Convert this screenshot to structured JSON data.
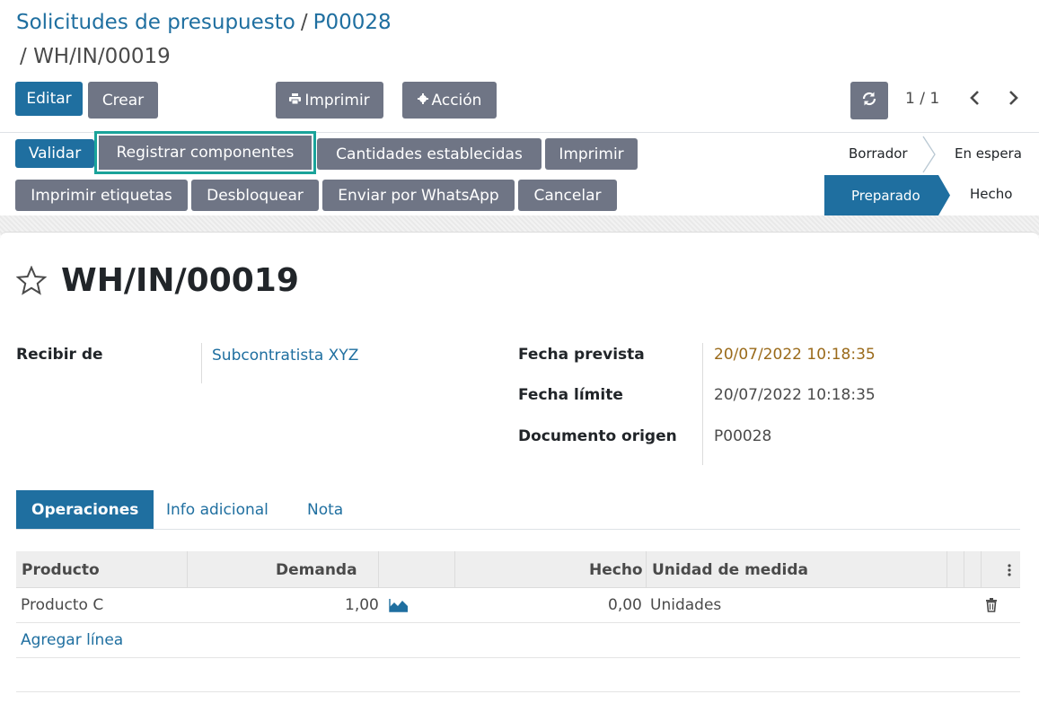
{
  "breadcrumb": {
    "root": "Solicitudes de presupuesto",
    "separator": "/",
    "parent": "P00028",
    "current_prefix": "/",
    "current": "WH/IN/00019"
  },
  "control_buttons": {
    "edit": "Editar",
    "create": "Crear",
    "print": "Imprimir",
    "action": "Acción"
  },
  "pager": {
    "value": "1 / 1"
  },
  "header_buttons": {
    "validate": "Validar",
    "register_components": "Registrar componentes",
    "set_quantities": "Cantidades establecidas",
    "print": "Imprimir",
    "print_labels": "Imprimir etiquetas",
    "unlock": "Desbloquear",
    "whatsapp": "Enviar por WhatsApp",
    "cancel": "Cancelar"
  },
  "status": {
    "stages": [
      "Borrador",
      "En espera",
      "Preparado",
      "Hecho"
    ],
    "active": "Preparado"
  },
  "record": {
    "title": "WH/IN/00019"
  },
  "fields": {
    "partner_label": "Recibir de",
    "partner_value": "Subcontratista XYZ",
    "scheduled_label": "Fecha prevista",
    "scheduled_value": "20/07/2022 10:18:35",
    "deadline_label": "Fecha límite",
    "deadline_value": "20/07/2022 10:18:35",
    "origin_label": "Documento origen",
    "origin_value": "P00028"
  },
  "tabs": [
    "Operaciones",
    "Info adicional",
    "Nota"
  ],
  "table": {
    "headers": [
      "Producto",
      "Demanda",
      "Hecho",
      "Unidad de medida"
    ],
    "rows": [
      {
        "product": "Producto C",
        "demand": "1,00",
        "done": "0,00",
        "uom": "Unidades"
      }
    ],
    "add_line": "Agregar línea"
  },
  "colors": {
    "primary": "#1f6fa0",
    "secondary": "#6f7585",
    "highlight": "#1aa39a",
    "warning_date": "#9a6a1a"
  },
  "icons": [
    "print-icon",
    "gear-icon",
    "refresh-icon",
    "chevron-left-icon",
    "chevron-right-icon",
    "star-icon",
    "area-chart-icon",
    "trash-icon",
    "kebab-menu-icon"
  ]
}
